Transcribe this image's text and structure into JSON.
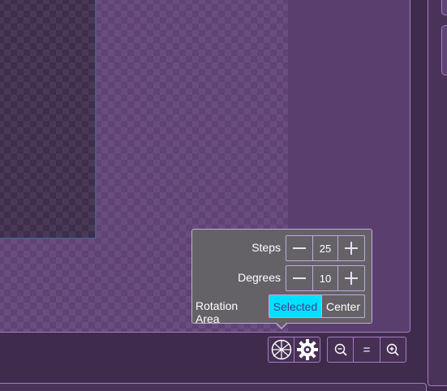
{
  "popover": {
    "steps_label": "Steps",
    "steps_value": "25",
    "degrees_label": "Degrees",
    "degrees_value": "10",
    "rotation_area_label": "Rotation Area",
    "rotation_area_options": [
      "Selected",
      "Center"
    ],
    "rotation_area_selected": "Selected"
  },
  "toolbar": {
    "zoom_reset_label": "="
  },
  "icons": {
    "rotate_tool": "radial-wheel-icon",
    "settings": "gear-icon",
    "zoom_out": "zoom-out-icon",
    "zoom_reset": "equals-icon",
    "zoom_in": "zoom-in-icon"
  },
  "colors": {
    "accent": "#00e1ff",
    "panel_border": "#a47bc4",
    "popover_bg": "#646266"
  }
}
